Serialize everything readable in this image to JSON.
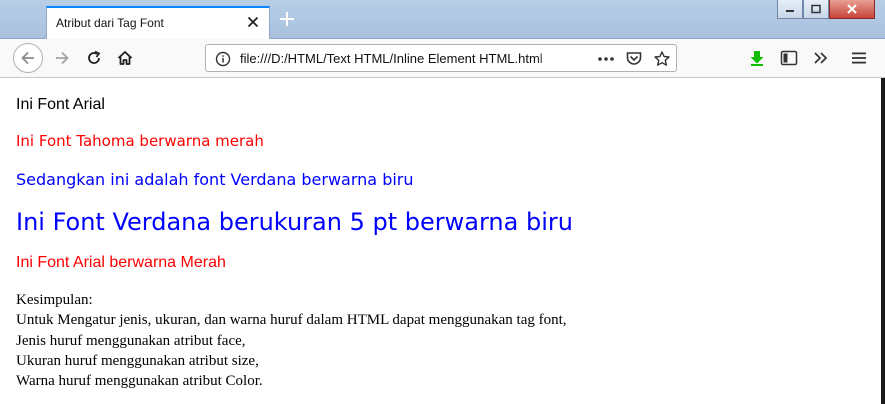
{
  "browser": {
    "tab_title": "Atribut dari Tag Font",
    "url": "file:///D:/HTML/Text HTML/Inline Element HTML.html"
  },
  "icons": {
    "back": "back-arrow-icon",
    "forward": "forward-arrow-icon",
    "reload": "reload-icon",
    "home": "home-icon",
    "info": "info-icon",
    "more": "more-horizontal-icon",
    "pocket": "pocket-icon",
    "bookmark": "star-icon",
    "download": "download-icon",
    "sidebar": "sidebar-icon",
    "overflow": "chevron-double-right-icon",
    "menu": "hamburger-menu-icon"
  },
  "page": {
    "line1": "Ini Font Arial",
    "line2": "Ini Font Tahoma berwarna merah",
    "line3": "Sedangkan ini adalah font Verdana berwarna biru",
    "line4": "Ini Font Verdana berukuran 5 pt berwarna biru",
    "line5": "Ini Font Arial berwarna Merah",
    "summary": [
      "Kesimpulan:",
      "Untuk Mengatur jenis, ukuran, dan warna huruf dalam HTML dapat menggunakan tag font,",
      "Jenis huruf menggunakan atribut face,",
      "Ukuran huruf menggunakan atribut size,",
      "Warna huruf menggunakan atribut Color."
    ]
  },
  "colors": {
    "red_text": "#ff0000",
    "blue_text": "#0000ff",
    "tab_accent": "#0a84ff",
    "download_green": "#12bc00"
  }
}
